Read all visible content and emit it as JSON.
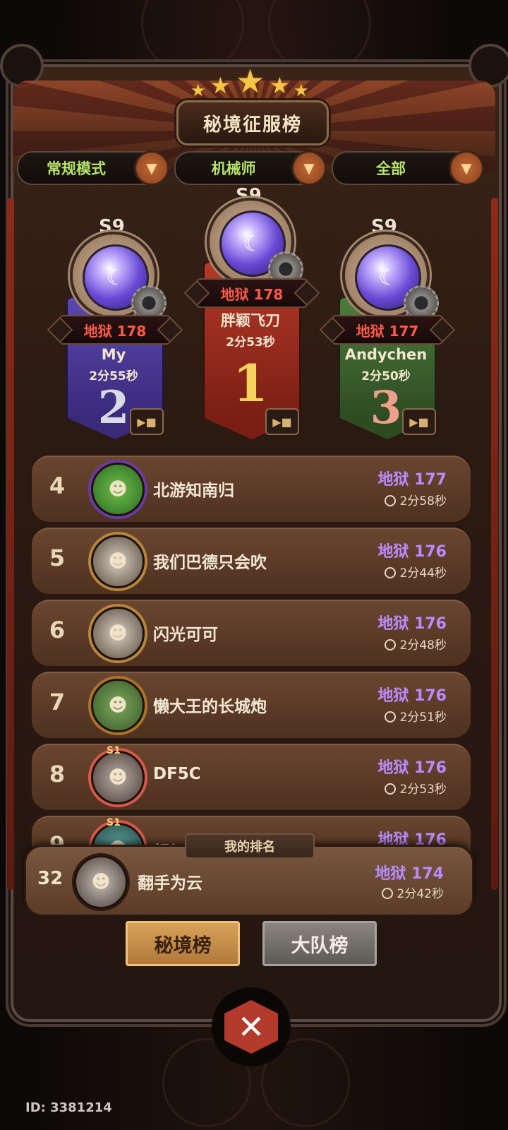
{
  "header": {
    "title": "秘境征服榜"
  },
  "filters": [
    {
      "label": "常规模式"
    },
    {
      "label": "机械师"
    },
    {
      "label": "全部"
    }
  ],
  "podium": [
    {
      "rank": "2",
      "season": "S9",
      "score": "地狱 178",
      "name": "My",
      "time": "2分55秒"
    },
    {
      "rank": "1",
      "season": "S9",
      "score": "地狱 178",
      "name": "胖颖飞刀",
      "time": "2分53秒"
    },
    {
      "rank": "3",
      "season": "S9",
      "score": "地狱 177",
      "name": "Andychen",
      "time": "2分50秒"
    }
  ],
  "rows": [
    {
      "rank": "4",
      "name": "北游知南归",
      "score": "地狱 177",
      "time": "2分58秒"
    },
    {
      "rank": "5",
      "name": "我们巴德只会吹",
      "score": "地狱 176",
      "time": "2分44秒"
    },
    {
      "rank": "6",
      "name": "闪光可可",
      "score": "地狱 176",
      "time": "2分48秒"
    },
    {
      "rank": "7",
      "name": "懒大王的长城炮",
      "score": "地狱 176",
      "time": "2分51秒"
    },
    {
      "rank": "8",
      "name": "DF5C",
      "score": "地狱 176",
      "time": "2分53秒"
    },
    {
      "rank": "9",
      "name": "超级",
      "score": "地狱 176"
    }
  ],
  "my_rank": {
    "tag": "我的排名",
    "rank": "32",
    "name": "翻手为云",
    "score": "地狱 174",
    "time": "2分42秒"
  },
  "tabs": [
    {
      "label": "秘境榜",
      "active": true
    },
    {
      "label": "大队榜",
      "active": false
    }
  ],
  "badges": {
    "s1": "S1"
  },
  "footer": {
    "uid": "ID: 3381214"
  },
  "colors": {
    "score_red": "#ff5a4a",
    "score_purple": "#b98bff",
    "filter_green": "#b7e36a"
  }
}
